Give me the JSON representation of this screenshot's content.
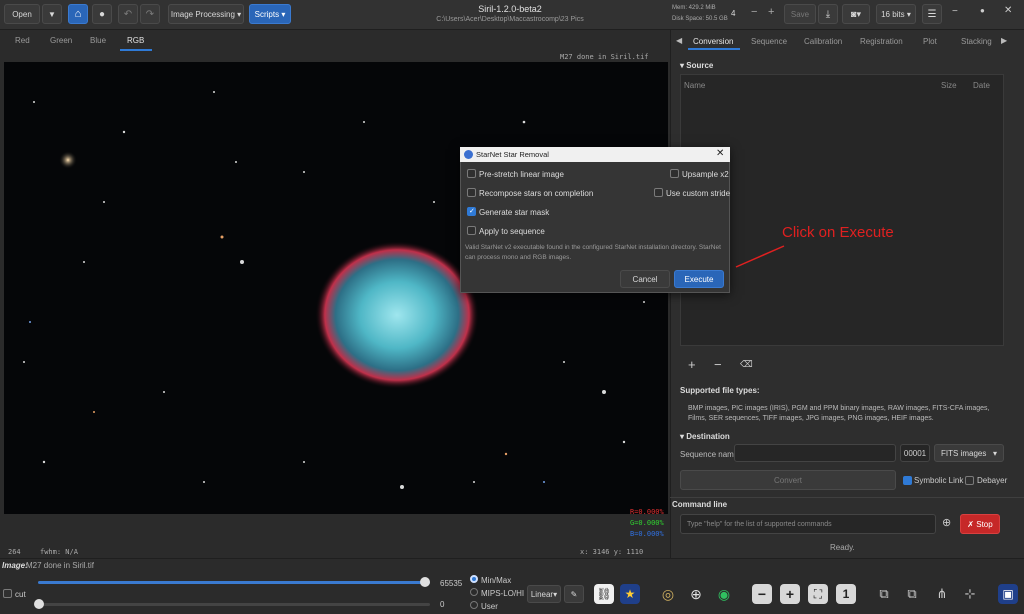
{
  "window": {
    "title": "Siril-1.2.0-beta2",
    "path": "C:\\Users\\Acer\\Desktop\\Maccastrocomp\\23 Pics",
    "mem": "Mem: 429.2 MiB",
    "disk": "Disk Space: 50.5 GB",
    "threads": "4",
    "bits": "16 bits"
  },
  "toolbar": {
    "open": "Open",
    "image_processing": "Image Processing",
    "scripts": "Scripts",
    "save": "Save"
  },
  "channel_tabs": [
    "Red",
    "Green",
    "Blue",
    "RGB"
  ],
  "image_overlay": {
    "filename_label": "M27 done in Siril.tif",
    "r_val": "R=0.000%",
    "g_val": "G=0.000%",
    "b_val": "B=0.000%",
    "left_status": "264",
    "fwhm": "fwhm: N/A",
    "coords": "x: 3146  y: 1110"
  },
  "right_tabs": [
    "Conversion",
    "Sequence",
    "Calibration",
    "Registration",
    "Plot",
    "Stacking"
  ],
  "source": {
    "header": "Source",
    "col_name": "Name",
    "col_size": "Size",
    "col_date": "Date",
    "supported_title": "Supported file types:",
    "supported_text": "BMP images, PIC images (IRIS), PGM and PPM binary images, RAW images, FITS-CFA images, Films, SER sequences, TIFF images, JPG images, PNG images, HEIF images."
  },
  "destination": {
    "header": "Destination",
    "seq_label": "Sequence name:",
    "seq_number": "00001",
    "format": "FITS images",
    "convert": "Convert",
    "symbolic": "Symbolic Link",
    "debayer": "Debayer"
  },
  "command_line": {
    "label": "Command line",
    "placeholder": "Type \"help\" for the list of supported commands",
    "stop": "Stop",
    "status": "Ready."
  },
  "dialog": {
    "title": "StarNet Star Removal",
    "opt_prestretch": "Pre-stretch linear image",
    "opt_recompose": "Recompose stars on completion",
    "opt_mask": "Generate star mask",
    "opt_sequence": "Apply to sequence",
    "opt_upsample": "Upsample x2",
    "opt_stride": "Use custom stride",
    "info": "Valid StarNet v2 executable found in the configured StarNet installation directory. StarNet can process mono and RGB images.",
    "cancel": "Cancel",
    "execute": "Execute"
  },
  "annotation": {
    "text": "Click on Execute"
  },
  "bottom": {
    "image_label": "Image:",
    "image_name": "M27 done in Siril.tif",
    "max_value": "65535",
    "min_value": "0",
    "cut": "cut",
    "minmax": "Min/Max",
    "mips": "MIPS-LO/HI",
    "user": "User",
    "scale": "Linear"
  },
  "colors": {
    "accent": "#2a66b8",
    "stop_red": "#c62828",
    "annotation_red": "#e02020"
  }
}
